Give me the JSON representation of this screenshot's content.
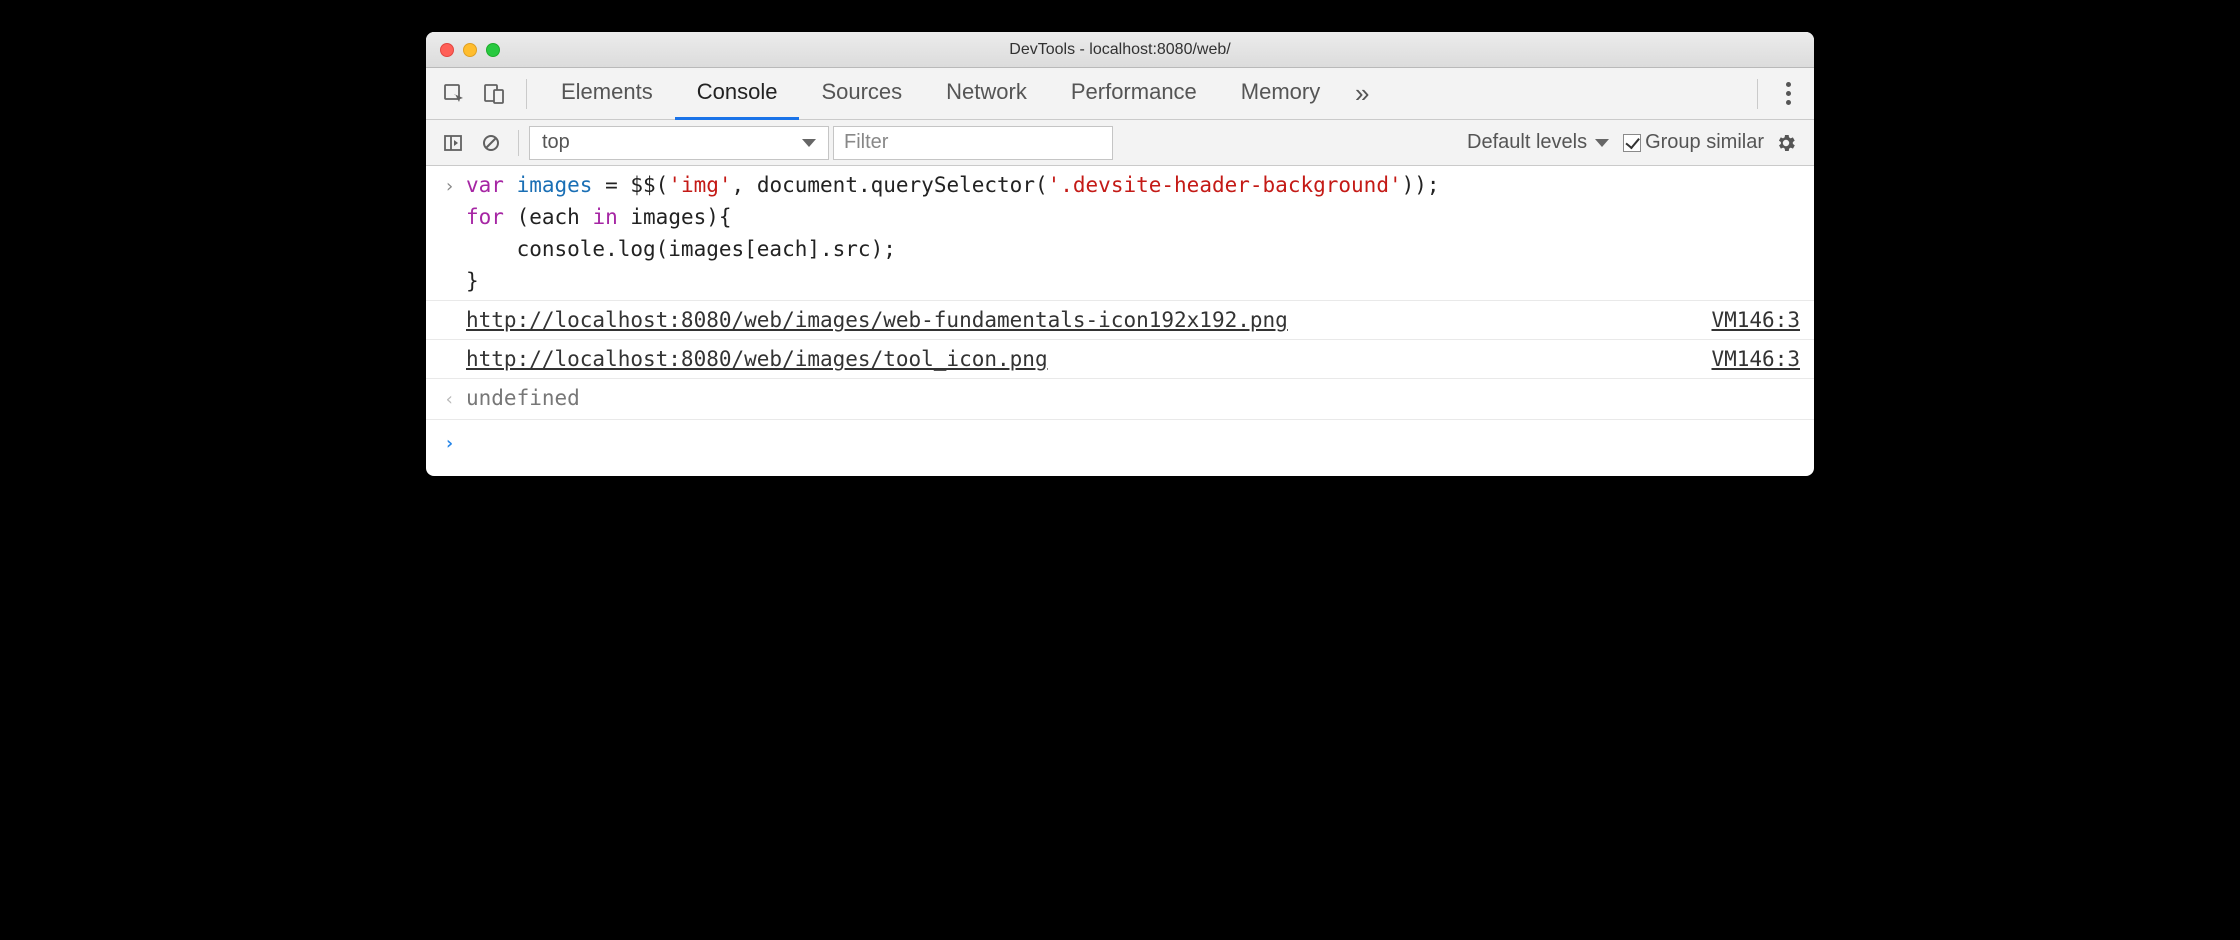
{
  "window": {
    "title": "DevTools - localhost:8080/web/"
  },
  "tabs": {
    "items": [
      "Elements",
      "Console",
      "Sources",
      "Network",
      "Performance",
      "Memory"
    ],
    "active_index": 1,
    "overflow": "»"
  },
  "toolbar": {
    "context": "top",
    "filter_placeholder": "Filter",
    "levels_label": "Default levels",
    "group_similar_checked": true,
    "group_similar_label": "Group similar"
  },
  "code": {
    "tokens": [
      {
        "t": "kw-var",
        "v": "var"
      },
      {
        "t": "plain",
        "v": " "
      },
      {
        "t": "ident",
        "v": "images"
      },
      {
        "t": "plain",
        "v": " = $$("
      },
      {
        "t": "str",
        "v": "'img'"
      },
      {
        "t": "plain",
        "v": ", document.querySelector("
      },
      {
        "t": "str",
        "v": "'.devsite-header-background'"
      },
      {
        "t": "plain",
        "v": "));"
      },
      {
        "t": "nl"
      },
      {
        "t": "kw-var",
        "v": "for"
      },
      {
        "t": "plain",
        "v": " (each "
      },
      {
        "t": "kw-in",
        "v": "in"
      },
      {
        "t": "plain",
        "v": " images){"
      },
      {
        "t": "nl"
      },
      {
        "t": "plain",
        "v": "    console.log(images[each].src);"
      },
      {
        "t": "nl"
      },
      {
        "t": "plain",
        "v": "}"
      }
    ]
  },
  "logs": [
    {
      "url": "http://localhost:8080/web/images/web-fundamentals-icon192x192.png",
      "source": "VM146:3"
    },
    {
      "url": "http://localhost:8080/web/images/tool_icon.png",
      "source": "VM146:3"
    }
  ],
  "return_value": "undefined",
  "gutters": {
    "input": "›",
    "output": "‹",
    "prompt": "›"
  }
}
